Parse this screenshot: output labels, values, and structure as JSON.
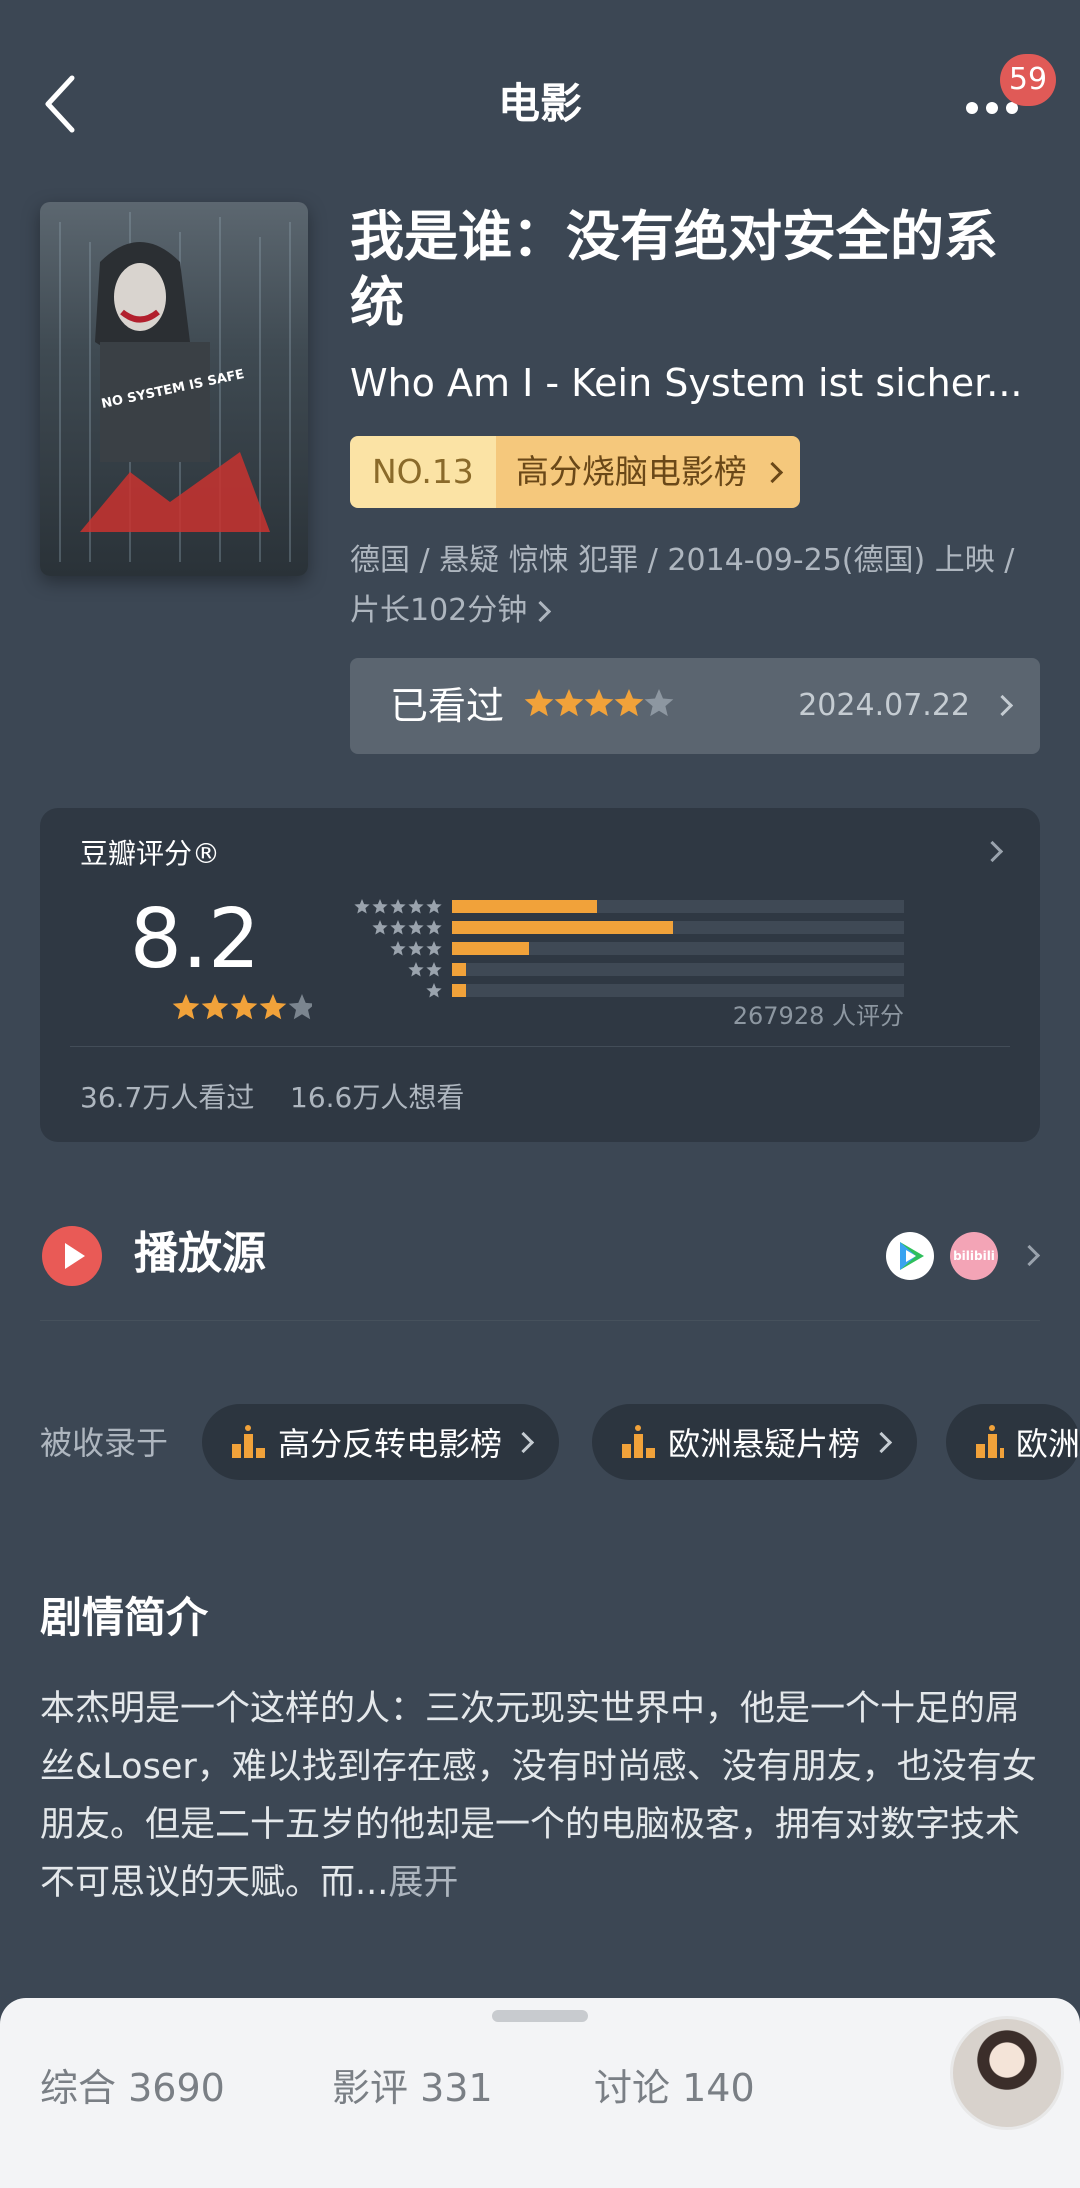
{
  "header": {
    "title": "电影",
    "notification_count": "59"
  },
  "movie": {
    "title_cn": "我是谁：没有绝对安全的系统",
    "title_original": "Who Am I - Kein System ist sicher...",
    "rank_no": "NO.13",
    "rank_list": "高分烧脑电影榜",
    "meta": "德国 / 悬疑 惊悚 犯罪 / 2014-09-25(德国) 上映 / 片长102分钟",
    "poster_text": "NO SYSTEM IS SAFE"
  },
  "watched": {
    "label": "已看过",
    "stars": 4,
    "date": "2024.07.22"
  },
  "rating": {
    "title": "豆瓣评分®",
    "score": "8.2",
    "stars": 4,
    "distribution": [
      0.32,
      0.49,
      0.17,
      0.03,
      0.03
    ],
    "count": "267928 人评分",
    "watched": "36.7万人看过",
    "want": "16.6万人想看"
  },
  "play_source": {
    "label": "播放源",
    "providers": [
      "tencent-video",
      "bilibili"
    ],
    "bili_text": "bilibili"
  },
  "collections": {
    "label": "被收录于",
    "items": [
      "高分反转电影榜",
      "欧洲悬疑片榜",
      "欧洲"
    ]
  },
  "synopsis": {
    "title": "剧情简介",
    "text": "本杰明是一个这样的人：三次元现实世界中，他是一个十足的屌丝&Loser，难以找到存在感，没有时尚感、没有朋友，也没有女朋友。但是二十五岁的他却是一个的电脑极客，拥有对数字技术不可思议的天赋。而...",
    "expand": "展开"
  },
  "tabs": [
    {
      "label": "综合",
      "count": "3690"
    },
    {
      "label": "影评",
      "count": "331"
    },
    {
      "label": "讨论",
      "count": "140"
    }
  ],
  "colors": {
    "background": "#3c4754",
    "accent": "#f1a23a",
    "card": "#2f3843",
    "play": "#e95a56",
    "rank": "#f5c87c"
  }
}
